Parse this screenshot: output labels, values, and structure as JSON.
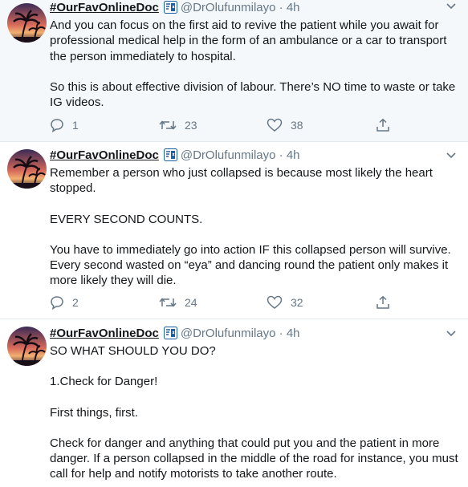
{
  "tweets": [
    {
      "author": {
        "name": "#OurFavOnlineDoc",
        "handle": "@DrOlufunmilayo",
        "time": "4h"
      },
      "paragraphs": [
        "And you can focus on the first aid to revive the patient while you await for professional medical help in the form of an ambulance or a car to transport the person immediately to hospital.",
        "So this is about effective division of labour. There’s NO time to waste or take IG videos."
      ],
      "replies": "1",
      "retweets": "23",
      "likes": "38"
    },
    {
      "author": {
        "name": "#OurFavOnlineDoc",
        "handle": "@DrOlufunmilayo",
        "time": "4h"
      },
      "paragraphs": [
        "Remember a person who just collapsed is because most likely the heart stopped.",
        "EVERY SECOND COUNTS.",
        "You have to immediately go into action IF this collapsed person will survive. Every second wasted on “eya” and dancing round the patient only makes it more likely they will die."
      ],
      "replies": "2",
      "retweets": "24",
      "likes": "32"
    },
    {
      "author": {
        "name": "#OurFavOnlineDoc",
        "handle": "@DrOlufunmilayo",
        "time": "4h"
      },
      "paragraphs": [
        "SO WHAT SHOULD YOU DO?",
        "1.Check for Danger!",
        "First things, first.",
        "Check for danger and anything that could put you and the patient in more danger. If a person collapsed in the middle of the road for instance, you must call for help and notify motorists to take another route."
      ]
    }
  ],
  "separator": "·",
  "icons": {
    "reply": "reply-icon",
    "retweet": "retweet-icon",
    "like": "heart-icon",
    "share": "share-icon",
    "more": "chevron-down-icon",
    "badge": "name-badge-icon"
  },
  "colors": {
    "text": "#14171a",
    "muted": "#657786",
    "highlight_bg": "#f5f8fa",
    "badge": "#1b5ea8",
    "divider": "#e1e8ed"
  }
}
